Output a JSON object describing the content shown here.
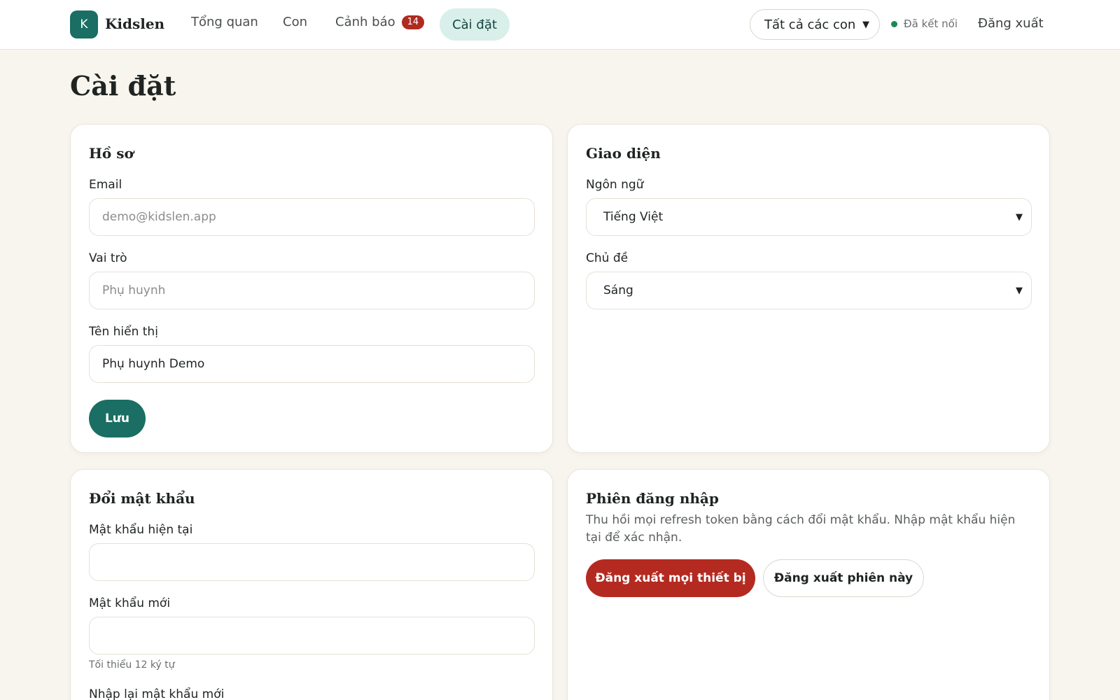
{
  "header": {
    "logo_letter": "K",
    "brand": "Kidslen",
    "nav": [
      {
        "label": "Tổng quan"
      },
      {
        "label": "Con"
      },
      {
        "label": "Cảnh báo",
        "badge": "14"
      },
      {
        "label": "Cài đặt"
      }
    ],
    "child_filter": "Tất cả các con",
    "connection_status": "Đã kết nối",
    "logout": "Đăng xuất"
  },
  "page_title": "Cài đặt",
  "profile": {
    "title": "Hồ sơ",
    "email_label": "Email",
    "email_value": "demo@kidslen.app",
    "role_label": "Vai trò",
    "role_value": "Phụ huynh",
    "display_name_label": "Tên hiển thị",
    "display_name_value": "Phụ huynh Demo",
    "save": "Lưu"
  },
  "appearance": {
    "title": "Giao diện",
    "language_label": "Ngôn ngữ",
    "language_value": "Tiếng Việt",
    "theme_label": "Chủ đề",
    "theme_value": "Sáng"
  },
  "password": {
    "title": "Đổi mật khẩu",
    "current_label": "Mật khẩu hiện tại",
    "new_label": "Mật khẩu mới",
    "new_hint": "Tối thiểu 12 ký tự",
    "confirm_label": "Nhập lại mật khẩu mới"
  },
  "sessions": {
    "title": "Phiên đăng nhập",
    "description": "Thu hồi mọi refresh token bằng cách đổi mật khẩu. Nhập mật khẩu hiện tại để xác nhận.",
    "logout_all": "Đăng xuất mọi thiết bị",
    "logout_this": "Đăng xuất phiên này"
  },
  "colors": {
    "accent": "#1a6e63",
    "danger": "#b42a21",
    "background": "#f8f5ee"
  }
}
